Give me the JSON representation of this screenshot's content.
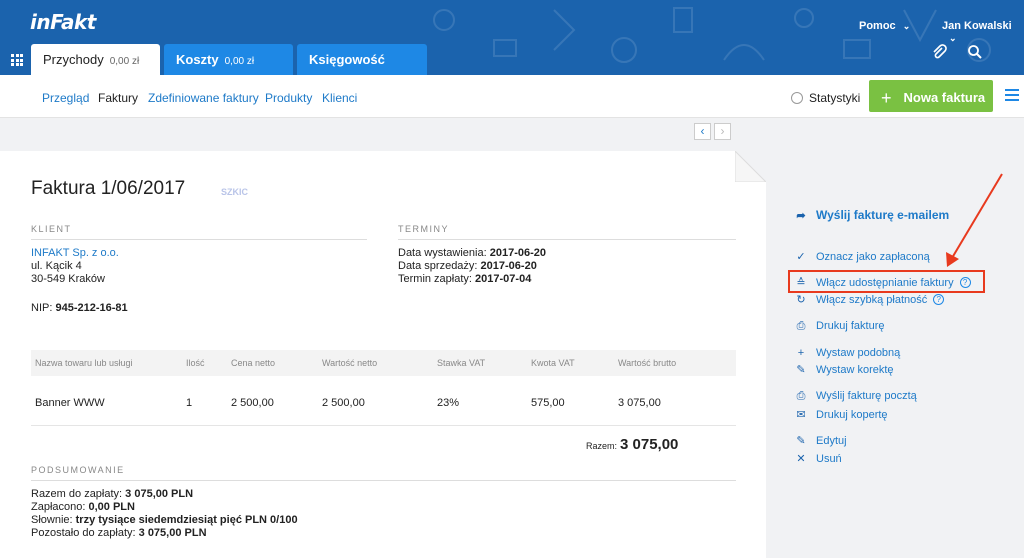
{
  "header": {
    "logo": "inFakt",
    "help": "Pomoc",
    "user": "Jan Kowalski",
    "tabs": [
      {
        "label": "Przychody",
        "amount": "0,00 zł"
      },
      {
        "label": "Koszty",
        "amount": "0,00 zł"
      },
      {
        "label": "Księgowość",
        "amount": ""
      }
    ]
  },
  "subnav": {
    "items": [
      "Przegląd",
      "Faktury",
      "Zdefiniowane faktury",
      "Produkty",
      "Klienci"
    ],
    "stats": "Statystyki",
    "new_invoice": "Nowa faktura"
  },
  "invoice": {
    "title": "Faktura 1/06/2017",
    "status": "SZKIC",
    "client_header": "KLIENT",
    "client_name": "INFAKT Sp. z o.o.",
    "client_street": "ul. Kącik 4",
    "client_city": "30-549 Kraków",
    "nip_label": "NIP:",
    "nip": "945-212-16-81",
    "terms_header": "TERMINY",
    "issue_label": "Data wystawienia:",
    "issue_date": "2017-06-20",
    "sale_label": "Data sprzedaży:",
    "sale_date": "2017-06-20",
    "due_label": "Termin zapłaty:",
    "due_date": "2017-07-04",
    "table_headers": [
      "Nazwa towaru lub usługi",
      "Ilość",
      "Cena netto",
      "Wartość netto",
      "Stawka VAT",
      "Kwota VAT",
      "Wartość brutto"
    ],
    "rows": [
      [
        "Banner WWW",
        "1",
        "2 500,00",
        "2 500,00",
        "23%",
        "575,00",
        "3 075,00"
      ]
    ],
    "total_label": "Razem:",
    "total": "3 075,00",
    "summary_header": "PODSUMOWANIE",
    "sum_due_label": "Razem do zapłaty:",
    "sum_due": "3 075,00 PLN",
    "paid_label": "Zapłacono:",
    "paid": "0,00 PLN",
    "words_label": "Słownie:",
    "words": "trzy tysiące siedemdziesiąt pięć PLN 0/100",
    "remaining_label": "Pozostało do zapłaty:",
    "remaining": "3 075,00 PLN"
  },
  "actions": {
    "send_email": "Wyślij fakturę e-mailem",
    "mark_paid": "Oznacz jako zapłaconą",
    "enable_sharing": "Włącz udostępnianie faktury",
    "enable_quick_pay": "Włącz szybką płatność",
    "print": "Drukuj fakturę",
    "similar": "Wystaw podobną",
    "correction": "Wystaw korektę",
    "send_post": "Wyślij fakturę pocztą",
    "print_envelope": "Drukuj kopertę",
    "edit": "Edytuj",
    "delete": "Usuń"
  },
  "colors": {
    "header_bg": "#1b63ad",
    "tab_blue": "#1e88e5",
    "link": "#1e7ac8",
    "new_button": "#7ac142",
    "highlight": "#e83a1e"
  }
}
